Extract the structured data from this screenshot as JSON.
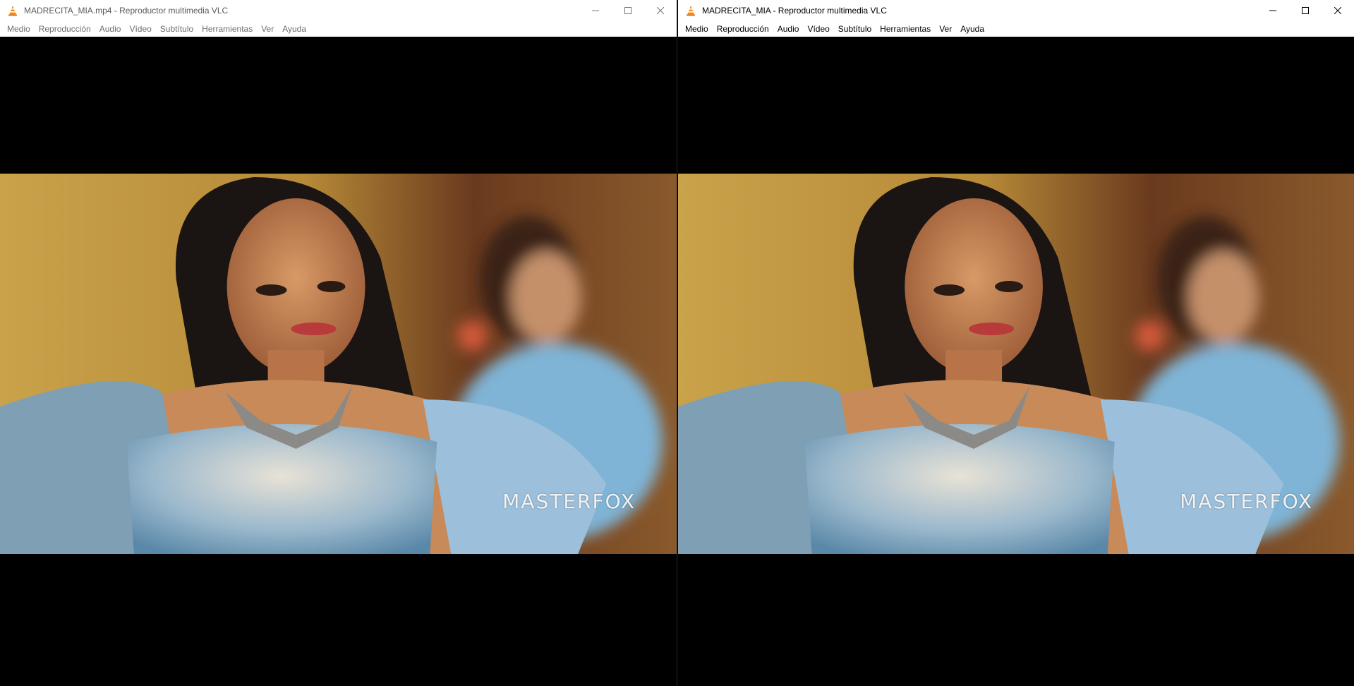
{
  "windows": [
    {
      "title": "MADRECITA_MIA.mp4 - Reproductor multimedia VLC",
      "active": false,
      "menu": [
        "Medio",
        "Reproducción",
        "Audio",
        "Vídeo",
        "Subtítulo",
        "Herramientas",
        "Ver",
        "Ayuda"
      ],
      "watermark": "MASTERFOX"
    },
    {
      "title": "MADRECITA_MIA - Reproductor multimedia VLC",
      "active": true,
      "menu": [
        "Medio",
        "Reproducción",
        "Audio",
        "Vídeo",
        "Subtítulo",
        "Herramientas",
        "Ver",
        "Ayuda"
      ],
      "watermark": "MASTERFOX"
    }
  ],
  "icons": {
    "app": "vlc-cone-icon",
    "minimize": "minimize-icon",
    "maximize": "maximize-icon",
    "close": "close-icon"
  },
  "colors": {
    "vlc_orange": "#f28a1d",
    "titlebar_bg": "#ffffff",
    "video_bg": "#000000"
  }
}
